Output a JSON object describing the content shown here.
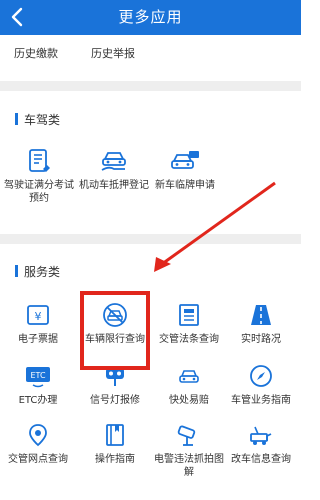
{
  "header": {
    "title": "更多应用"
  },
  "history": [
    "历史缴款",
    "历史举报"
  ],
  "section1": {
    "title": "车驾类",
    "items": [
      "驾驶证满分考试预约",
      "机动车抵押登记",
      "新车临牌申请"
    ]
  },
  "section2": {
    "title": "服务类",
    "items": [
      "电子票据",
      "车辆限行查询",
      "交管法条查询",
      "实时路况",
      "ETC办理",
      "信号灯报修",
      "快处易赔",
      "车管业务指南",
      "交管网点查询",
      "操作指南",
      "电警违法抓拍图解",
      "改车信息查询"
    ]
  },
  "icons": {
    "etc_badge": "ETC"
  },
  "colors": {
    "primary": "#1a73d9",
    "highlight": "#e1261c"
  }
}
